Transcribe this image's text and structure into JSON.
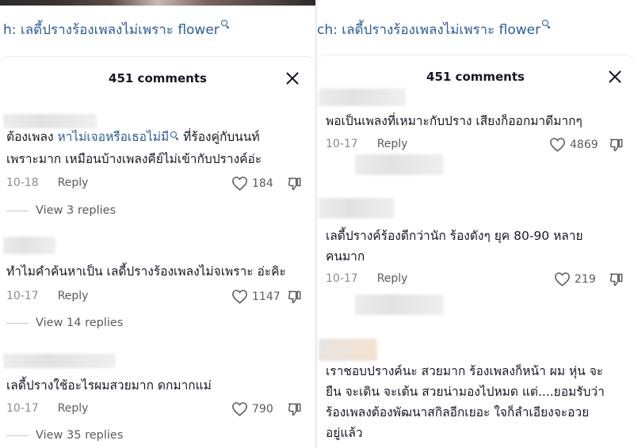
{
  "left": {
    "search_prefix": "h:",
    "search_query": "เลดี้ปรางร้องเพลงไม่เพราะ flower",
    "comments_header": "451 comments",
    "comments": [
      {
        "text_line1_pre": "ต้องเพลง ",
        "text_line1_link": "หาไม่เจอหรือเธอไม่มี",
        "text_line1_post": " ที่ร้องคู่กับนนท์",
        "text_line2": "เพราะมาก เหมือนบ้างเพลงคีย์ไม่เข้ากับปรางค์อ่ะ",
        "date": "10-18",
        "reply": "Reply",
        "likes": "184",
        "view_replies": "View 3 replies"
      },
      {
        "text_line1": "ทำไมคำค้นหาเป็น เลดี้ปรางร้องเพลงไม่จเพราะ อ่ะคิะ",
        "date": "10-17",
        "reply": "Reply",
        "likes": "1147",
        "view_replies": "View 14 replies"
      },
      {
        "text_line1": "เลดี้ปรางใช้อะไรผมสวยมาก ดกมากแม่",
        "date": "10-17",
        "reply": "Reply",
        "likes": "790",
        "view_replies": "View 35 replies"
      }
    ]
  },
  "right": {
    "search_prefix": "ch:",
    "search_query": "เลดี้ปรางร้องเพลงไม่เพราะ flower",
    "comments_header": "451 comments",
    "comments": [
      {
        "text_line1": "พอเป็นเพลงที่เหมาะกับปราง เสียงก็ออกมาดีมากๆ",
        "date": "10-17",
        "reply": "Reply",
        "likes": "4869"
      },
      {
        "text_line1": "เลดี้ปรางค์ร้องดีกว่านัก ร้องดังๆ ยุค  80-90 หลาย",
        "text_line2": "คนมาก",
        "date": "10-17",
        "reply": "Reply",
        "likes": "219"
      },
      {
        "text_line1": "เราชอบปรางค์นะ สวยมาก ร้องเพลงก็หน้า ผม หุ่น จะ",
        "text_line2": "ยืน จะเดิน จะเต้น สวยน่ามองไปหมด แต่....ยอมรับว่า",
        "text_line3": "ร้องเพลงต้องพัฒนาสกิลอีกเยอะ ใจก็ลำเอียงจะอวย",
        "text_line4": "อยู่แล้ว"
      }
    ]
  },
  "icons": {
    "close": "close-icon",
    "heart": "heart-icon",
    "dislike": "dislike-icon",
    "search": "search-icon"
  },
  "colors": {
    "link": "#2a5d9f",
    "text": "#161823",
    "muted": "#8a8b91"
  }
}
